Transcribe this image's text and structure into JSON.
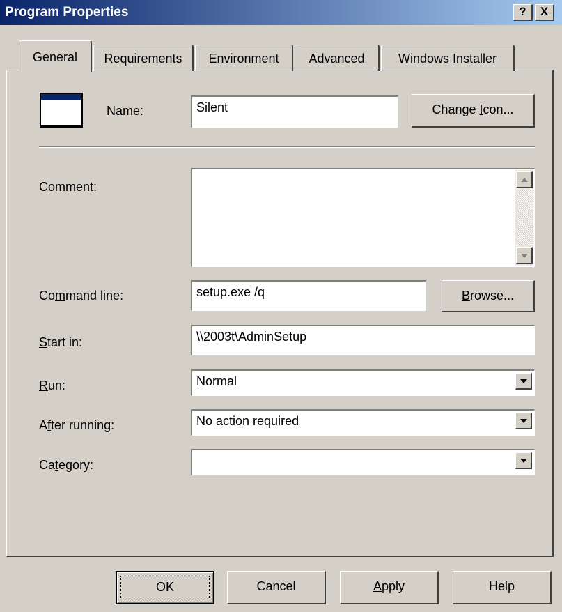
{
  "window": {
    "title": "Program Properties",
    "help_button": "?",
    "close_button": "X"
  },
  "tabs": [
    {
      "label": "General",
      "active": true
    },
    {
      "label": "Requirements",
      "active": false
    },
    {
      "label": "Environment",
      "active": false
    },
    {
      "label": "Advanced",
      "active": false
    },
    {
      "label": "Windows Installer",
      "active": false
    }
  ],
  "general": {
    "name": {
      "label_key": "N",
      "label_rest": "ame:",
      "value": "Silent"
    },
    "change_icon": {
      "label_pre": "Change ",
      "label_key": "I",
      "label_rest": "con..."
    },
    "comment": {
      "label_key": "C",
      "label_rest": "omment:",
      "value": ""
    },
    "command_line": {
      "label_pre": "Co",
      "label_key": "m",
      "label_rest": "mand line:",
      "value": "setup.exe /q"
    },
    "browse": {
      "label_key": "B",
      "label_rest": "rowse..."
    },
    "start_in": {
      "label_key": "S",
      "label_rest": "tart in:",
      "value": "\\\\2003t\\AdminSetup"
    },
    "run": {
      "label_key": "R",
      "label_rest": "un:",
      "value": "Normal"
    },
    "after_running": {
      "label_pre": "A",
      "label_key": "f",
      "label_rest": "ter running:",
      "value": "No action required"
    },
    "category": {
      "label_pre": "Ca",
      "label_key": "t",
      "label_rest": "egory:",
      "value": ""
    }
  },
  "buttons": {
    "ok": "OK",
    "cancel": "Cancel",
    "apply_key": "A",
    "apply_rest": "pply",
    "help": "Help"
  },
  "icons": {
    "program_icon": "window-application-icon",
    "dropdown": "chevron-down-icon",
    "scroll_up": "scroll-up-arrow-icon",
    "scroll_down": "scroll-down-arrow-icon"
  },
  "colors": {
    "title_gradient_start": "#0a246a",
    "title_gradient_end": "#a6caf0",
    "face": "#d4d0c8"
  }
}
